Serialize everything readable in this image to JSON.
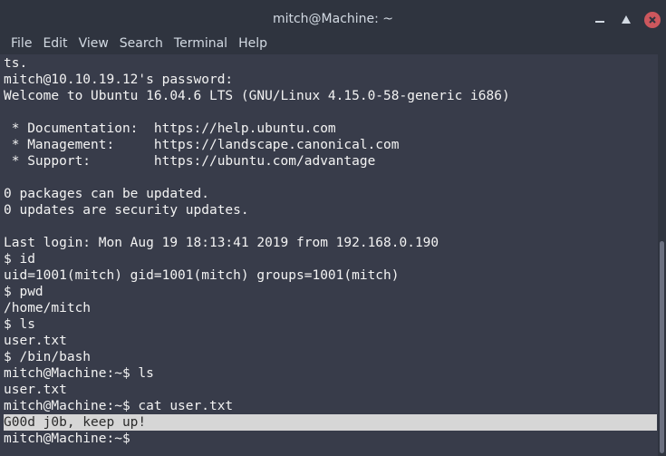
{
  "window": {
    "title": "mitch@Machine: ~"
  },
  "menu": {
    "items": [
      "File",
      "Edit",
      "View",
      "Search",
      "Terminal",
      "Help"
    ]
  },
  "terminal": {
    "lines": [
      "ts.",
      "mitch@10.10.19.12's password:",
      "Welcome to Ubuntu 16.04.6 LTS (GNU/Linux 4.15.0-58-generic i686)",
      "",
      " * Documentation:  https://help.ubuntu.com",
      " * Management:     https://landscape.canonical.com",
      " * Support:        https://ubuntu.com/advantage",
      "",
      "0 packages can be updated.",
      "0 updates are security updates.",
      "",
      "Last login: Mon Aug 19 18:13:41 2019 from 192.168.0.190",
      "$ id",
      "uid=1001(mitch) gid=1001(mitch) groups=1001(mitch)",
      "$ pwd",
      "/home/mitch",
      "$ ls",
      "user.txt",
      "$ /bin/bash",
      "mitch@Machine:~$ ls",
      "user.txt",
      "mitch@Machine:~$ cat user.txt"
    ],
    "highlighted_line": "G00d j0b, keep up!",
    "prompt_line": "mitch@Machine:~$ "
  },
  "icons": {
    "minimize": "minimize-icon",
    "maximize": "maximize-icon",
    "close": "close-icon"
  },
  "colors": {
    "titlebar": "#2f343f",
    "terminal_bg": "#383c4a",
    "text": "#f3f3f3",
    "selection": "#d6d6d6",
    "close_button": "#cc575d"
  }
}
